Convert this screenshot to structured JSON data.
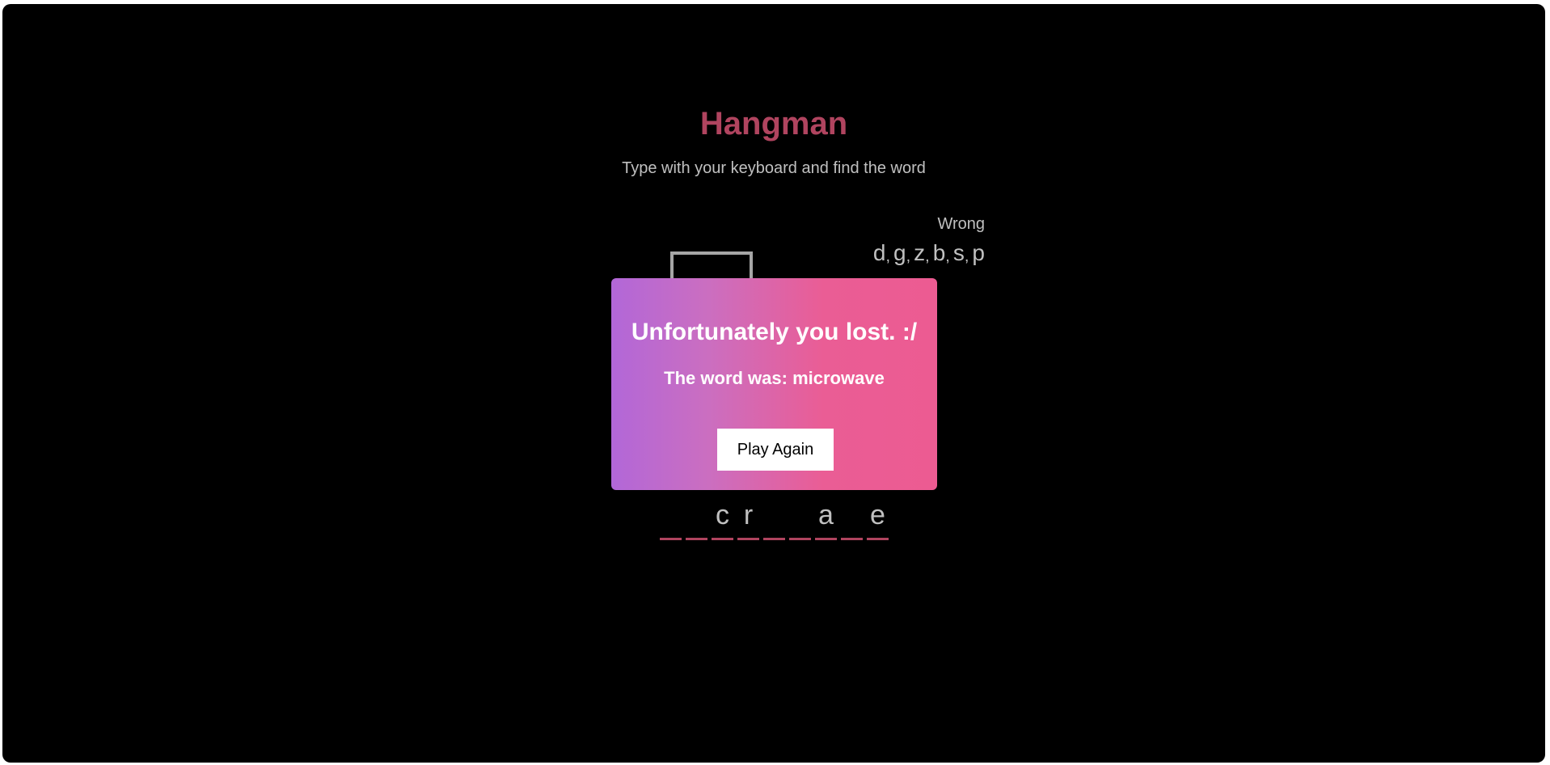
{
  "header": {
    "title": "Hangman",
    "subtitle": "Type with your keyboard and find the word"
  },
  "wrong": {
    "label": "Wrong",
    "letters": [
      "d",
      "g",
      "z",
      "b",
      "s",
      "p"
    ]
  },
  "word": {
    "slots": [
      "",
      "",
      "c",
      "r",
      "",
      "",
      "a",
      "",
      "e"
    ]
  },
  "popup": {
    "title": "Unfortunately you lost. :/",
    "message": "The word was: microwave",
    "button_label": "Play Again"
  },
  "colors": {
    "accent": "#b0445f",
    "text_muted": "#c0c0c0",
    "popup_gradient_start": "#b267d8",
    "popup_gradient_end": "#ec5b92"
  }
}
